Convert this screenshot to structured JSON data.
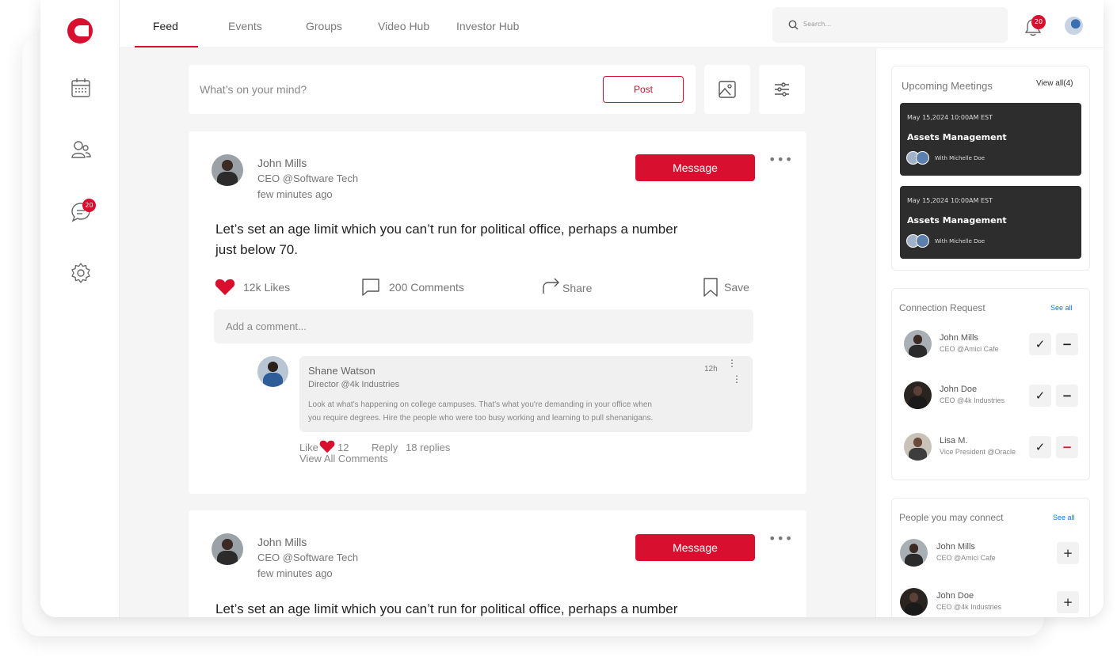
{
  "nav": {
    "tabs": [
      "Feed",
      "Events",
      "Groups",
      "Video Hub",
      "Investor Hub"
    ],
    "search_placeholder": "Search...",
    "notification_count": "20",
    "messages_count": "20",
    "rail_icons": [
      "calendar-icon",
      "users-icon",
      "chat-icon",
      "settings-icon"
    ]
  },
  "composer": {
    "placeholder": "What’s on your mind?",
    "post_label": "Post"
  },
  "posts": [
    {
      "author": "John Mills",
      "role": "CEO @Software Tech",
      "time": "few minutes ago",
      "message_label": "Message",
      "text_line1": "Let’s set an age limit which you can’t run for political office, perhaps a number",
      "text_line2": "just below 70.",
      "likes": "12k Likes",
      "comments": "200 Comments",
      "share": "Share",
      "save": "Save",
      "add_comment_placeholder": "Add a comment...",
      "reply": {
        "author": "Shane Watson",
        "role": "Director @4k Industries",
        "time": "12h",
        "text_line1": "Look at what's happening on college campuses. That's what you're demanding in your office when",
        "text_line2": "you require degrees. Hire the people who were too busy working and learning to pull shenanigans.",
        "like_label": "Like",
        "like_count": "12",
        "reply_label": "Reply",
        "replies": "18 replies",
        "view_all": "View All Comments"
      }
    },
    {
      "author": "John Mills",
      "role": "CEO @Software Tech",
      "time": "few minutes ago",
      "message_label": "Message",
      "text_line1": "Let’s set an age limit which you can’t run for political office, perhaps a number"
    }
  ],
  "meetings": {
    "title": "Upcoming Meetings",
    "view_all": "View all(4)",
    "items": [
      {
        "date": "May 15,2024",
        "time": "10:00AM EST",
        "title": "Assets Management",
        "with": "With Michelle Doe"
      },
      {
        "date": "May 15,2024",
        "time": "10:00AM EST",
        "title": "Assets Management",
        "with": "With Michelle Doe"
      }
    ]
  },
  "connections": {
    "title": "Connection Request",
    "see_all": "See all",
    "items": [
      {
        "name": "John Mills",
        "role": "CEO @Amici Cafe"
      },
      {
        "name": "John Doe",
        "role": "CEO @4k Industries"
      },
      {
        "name": "Lisa M.",
        "role": "Vice President @Oracle"
      }
    ]
  },
  "suggestions": {
    "title": "People you may connect",
    "see_all": "See all",
    "items": [
      {
        "name": "John Mills",
        "role": "CEO @Amici Cafe"
      },
      {
        "name": "John Doe",
        "role": "CEO @4k Industries"
      }
    ]
  },
  "colors": {
    "accent": "#d80f2f",
    "dark_card": "#2d2d2d",
    "link": "#1a73e8"
  }
}
